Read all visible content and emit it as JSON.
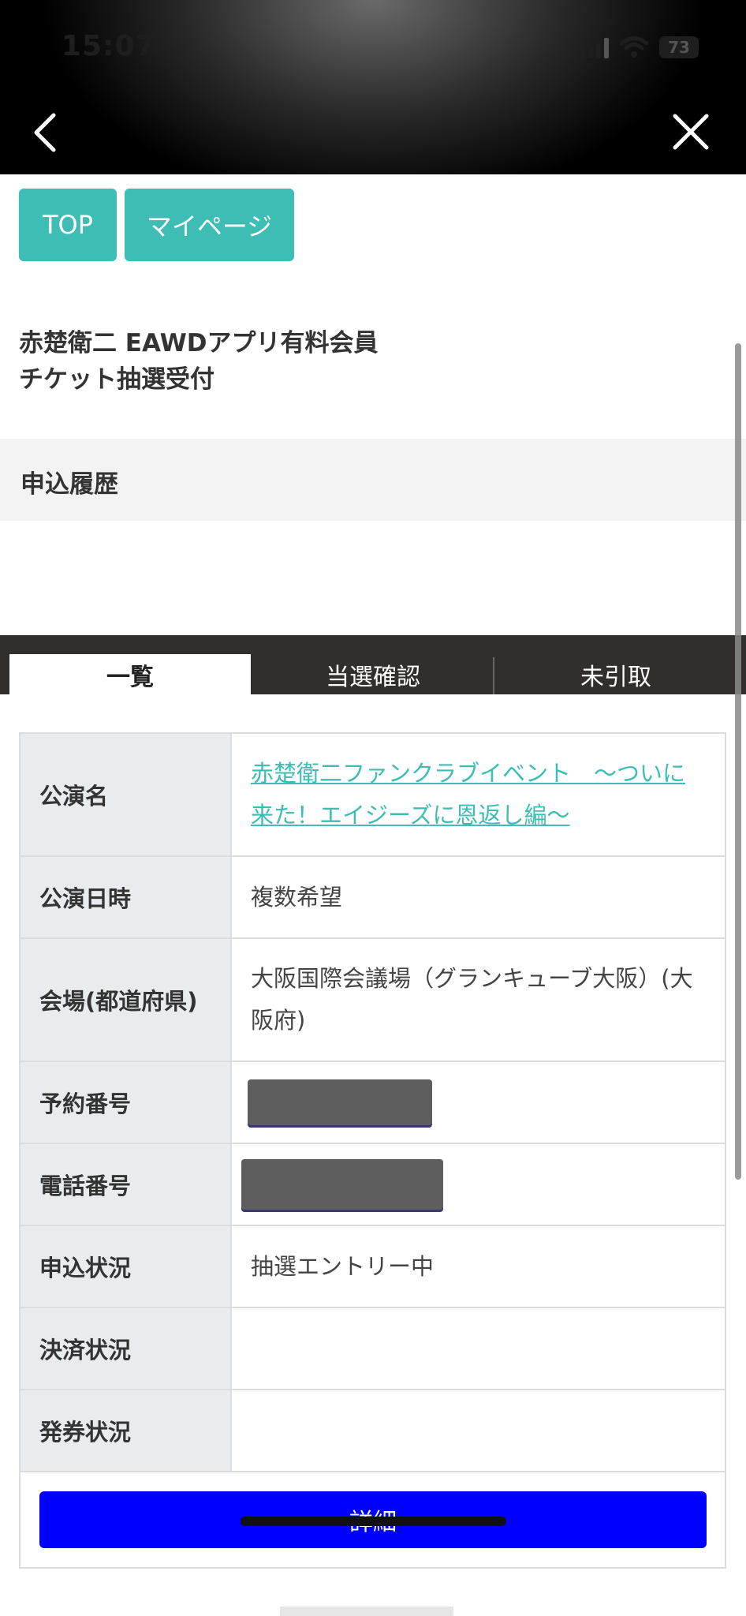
{
  "status_bar": {
    "time": "15:07",
    "battery": "73"
  },
  "nav": {
    "back_icon": "chevron-left-icon",
    "close_icon": "close-icon"
  },
  "buttons": {
    "top": "TOP",
    "mypage": "マイページ"
  },
  "title": {
    "line1": "赤楚衛二 EAWDアプリ有料会員",
    "line2": "チケット抽選受付"
  },
  "section": {
    "title": "申込履歴"
  },
  "tabs": [
    {
      "label": "一覧",
      "active": true
    },
    {
      "label": "当選確認",
      "active": false
    },
    {
      "label": "未引取",
      "active": false
    }
  ],
  "details": {
    "performance_name_label": "公演名",
    "performance_name": "赤楚衛二ファンクラブイベント　〜ついに来た！エイジーズに恩返し編〜",
    "datetime_label": "公演日時",
    "datetime": "複数希望",
    "venue_label": "会場(都道府県)",
    "venue": "大阪国際会議場（グランキューブ大阪）(大阪府)",
    "reservation_label": "予約番号",
    "phone_label": "電話番号",
    "application_status_label": "申込状況",
    "application_status": "抽選エントリー中",
    "payment_status_label": "決済状況",
    "ticketing_status_label": "発券状況",
    "detail_button": "詳細"
  },
  "colors": {
    "teal": "#3dbdb4",
    "detail_button": "#0000ff",
    "tab_bar": "#322e2c"
  }
}
